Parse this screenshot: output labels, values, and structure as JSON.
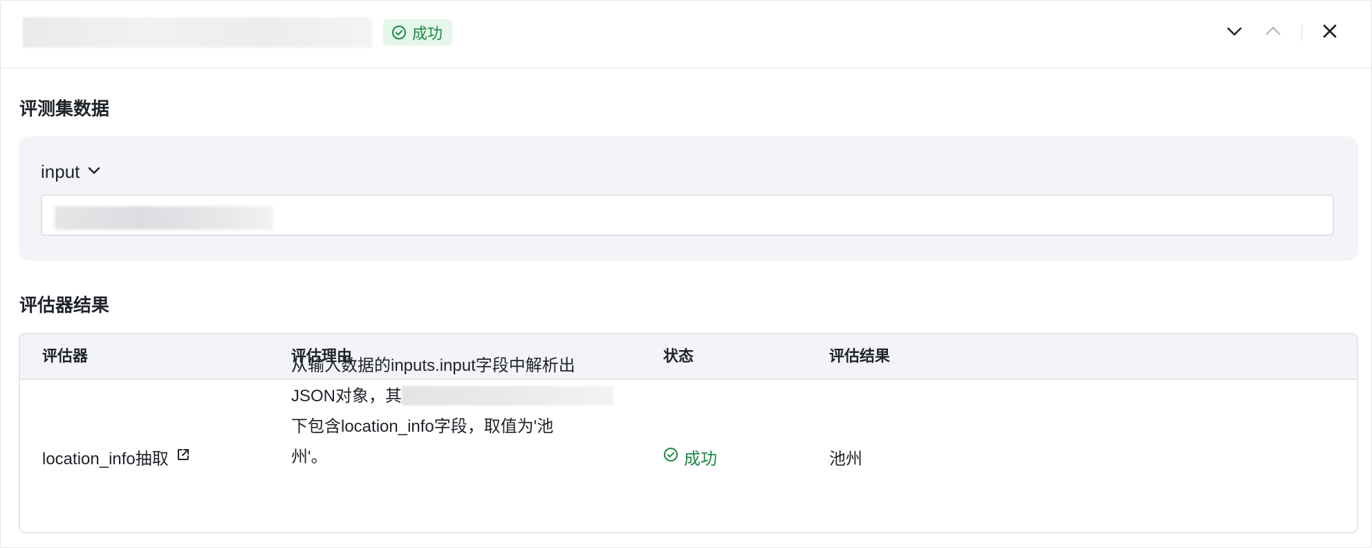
{
  "header": {
    "status_label": "成功",
    "icons": {
      "status": "check-circle-icon",
      "next": "chevron-down-icon",
      "prev": "chevron-up-icon",
      "close": "close-icon"
    }
  },
  "dataset_section": {
    "title": "评测集数据",
    "field_name": "input"
  },
  "evaluator_section": {
    "title": "评估器结果",
    "columns": [
      "评估器",
      "评估理由",
      "状态",
      "评估结果"
    ],
    "rows": [
      {
        "evaluator": "location_info抽取",
        "reason_lines": [
          "从输入数据的inputs.input字段中解析出",
          "JSON对象，其",
          "下包含location_info字段，取值为'池",
          "州'。"
        ],
        "status": "成功",
        "result": "池州"
      }
    ]
  },
  "colors": {
    "success_text": "#1a8a43",
    "success_bg": "#e5f6ea",
    "card_bg": "#f3f4f7",
    "border": "#e3e5ea"
  }
}
